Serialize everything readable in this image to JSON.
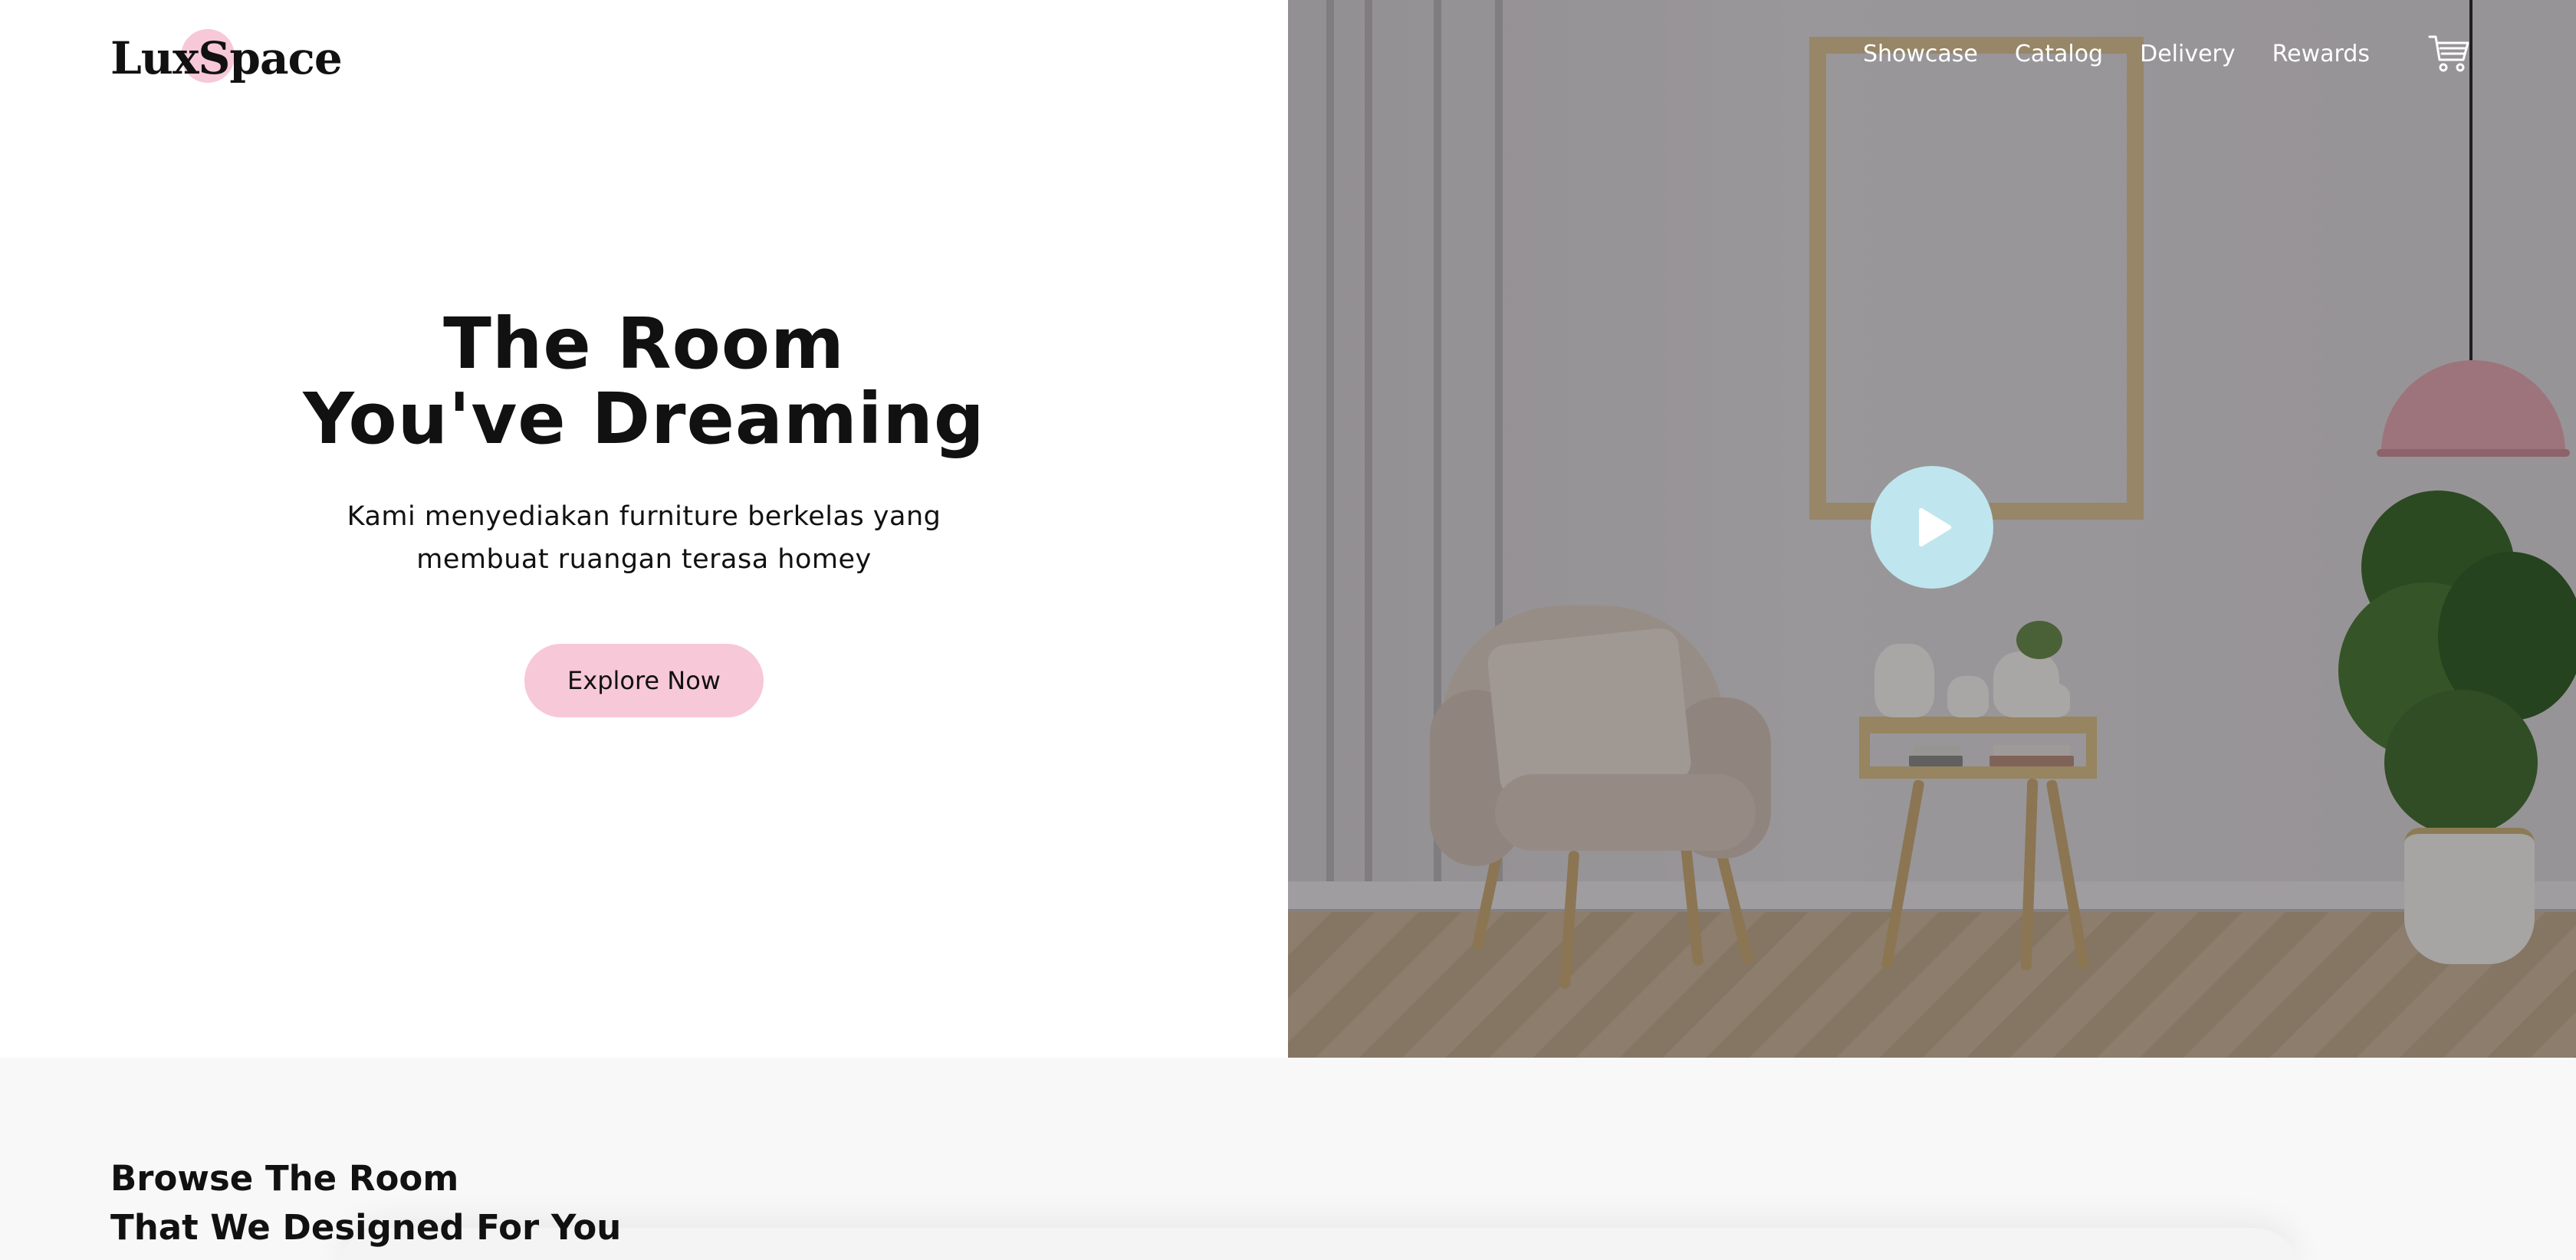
{
  "brand": {
    "name": "LuxSpace",
    "accent": "#f7c8d8"
  },
  "nav": {
    "links": [
      "Showcase",
      "Catalog",
      "Delivery",
      "Rewards"
    ],
    "cart_icon": "cart-icon"
  },
  "hero": {
    "title_line1": "The Room",
    "title_line2": "You've Dreaming",
    "subtitle_line1": "Kami menyediakan furniture berkelas yang",
    "subtitle_line2": "membuat ruangan terasa homey",
    "cta_label": "Explore Now",
    "play_icon": "play-icon",
    "play_color": "#bfe6ee"
  },
  "browse": {
    "title_line1": "Browse The Room",
    "title_line2": "That We Designed For You"
  }
}
